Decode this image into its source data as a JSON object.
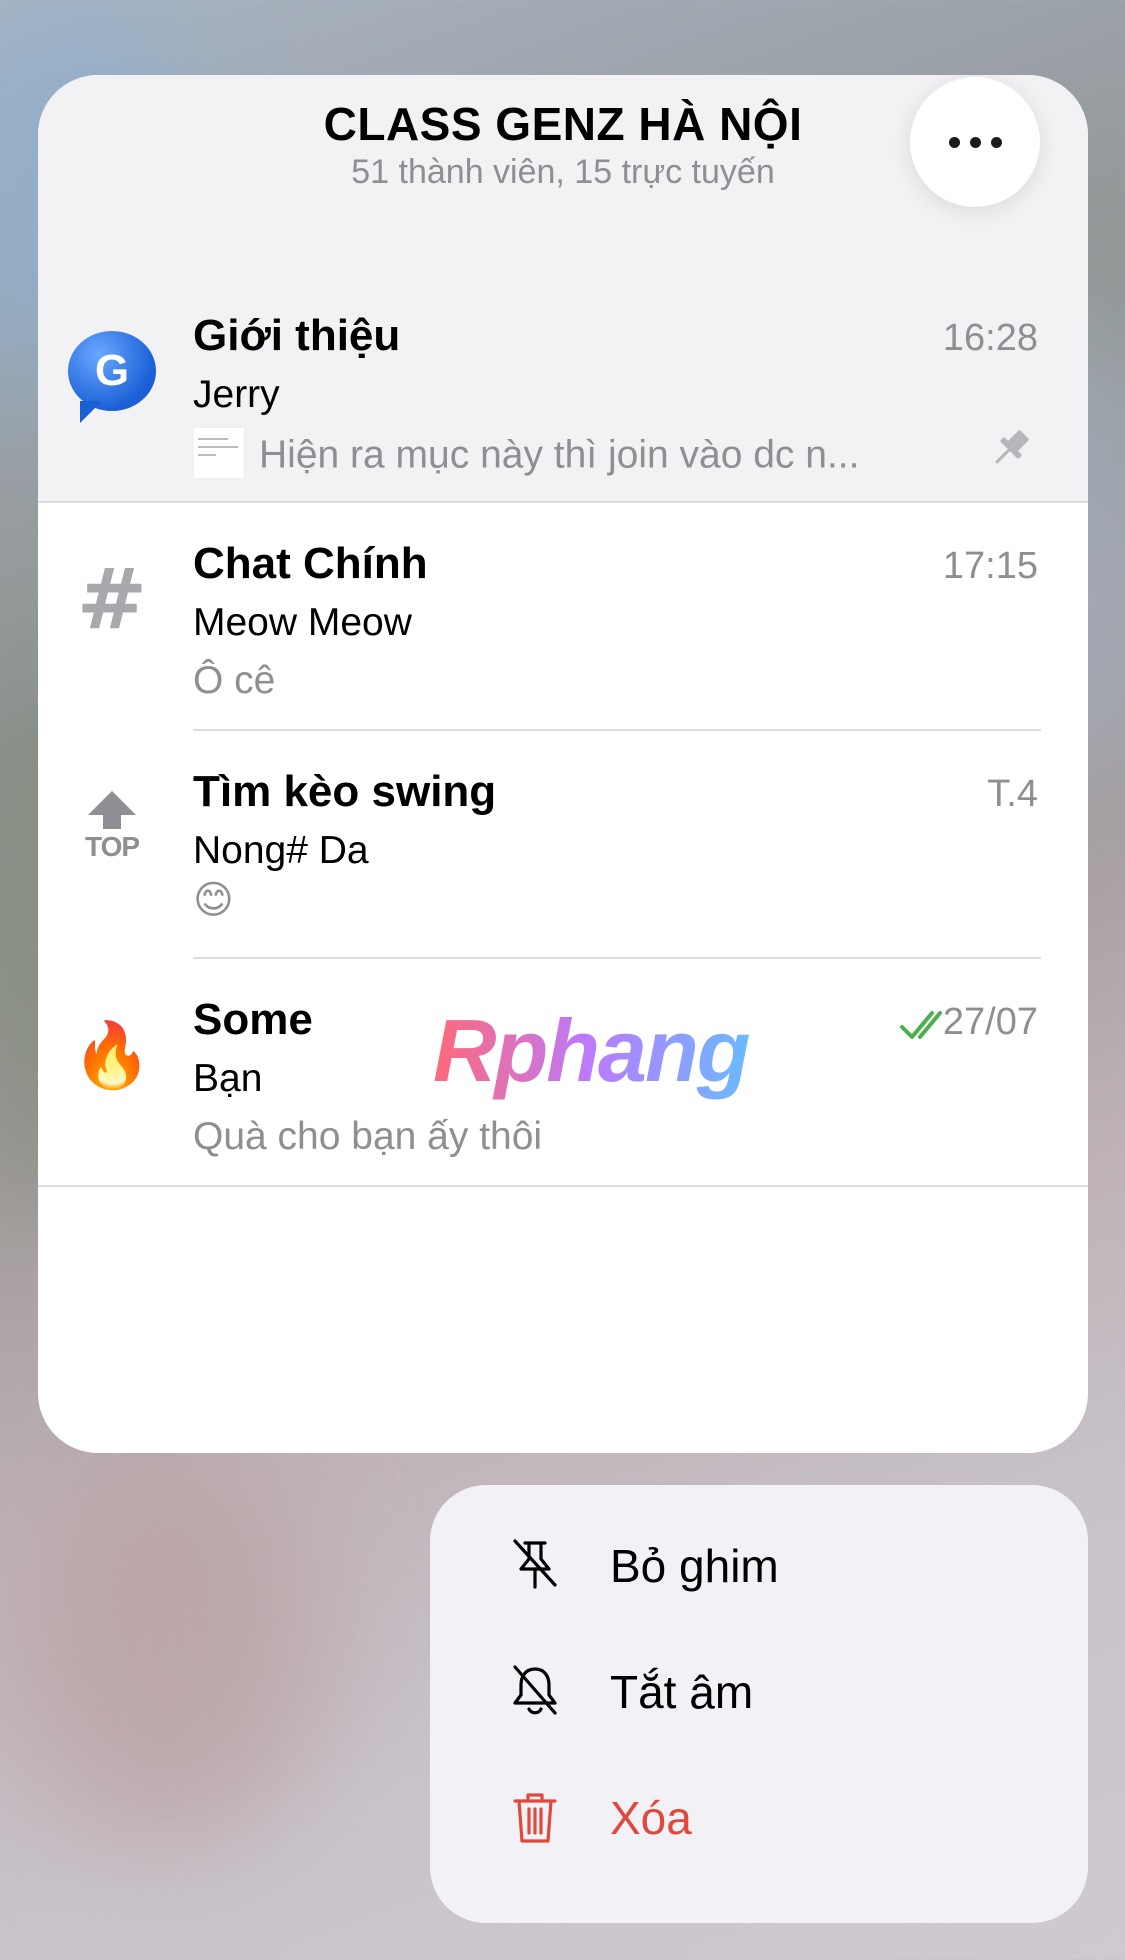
{
  "group": {
    "title": "CLASS GENZ HÀ NỘI",
    "subtitle": "51 thành viên, 15 trực tuyến"
  },
  "chats": [
    {
      "name": "Giới thiệu",
      "time": "16:28",
      "sender": "Jerry",
      "message": "Hiện ra mục này thì join vào dc n...",
      "pinned": true,
      "icon": "g-bubble-icon"
    },
    {
      "name": "Chat Chính",
      "time": "17:15",
      "sender": "Meow Meow",
      "message": "Ô cê",
      "icon": "hashtag-icon"
    },
    {
      "name": "Tìm kèo swing",
      "time": "T.4",
      "sender": "Nong# Da",
      "message": "😊",
      "icon": "top-arrow-icon"
    },
    {
      "name": "Some",
      "time": "27/07",
      "sender": "Bạn",
      "message": "Quà cho bạn ấy thôi",
      "icon": "fire-icon",
      "read": true
    }
  ],
  "watermark": "Rphang",
  "menu": {
    "unpin": "Bỏ ghim",
    "mute": "Tắt âm",
    "delete": "Xóa"
  },
  "colors": {
    "danger": "#e0483e",
    "read_check": "#4cb04c",
    "secondary_text": "#8e8e93"
  }
}
